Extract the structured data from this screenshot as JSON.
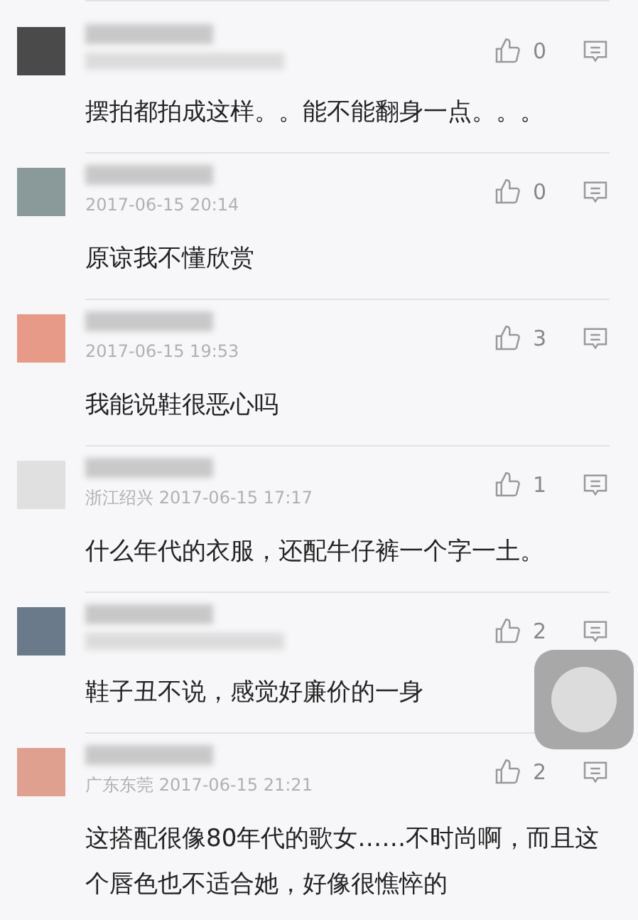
{
  "comments": [
    {
      "color": "#4a4a4a",
      "likes": "0",
      "text": "摆拍都拍成这样。。能不能翻身一点。。。"
    },
    {
      "color": "#8a9a9a",
      "meta": "2017-06-15 20:14",
      "likes": "0",
      "text": "原谅我不懂欣赏"
    },
    {
      "color": "#e89a88",
      "meta": "2017-06-15 19:53",
      "likes": "3",
      "text": "我能说鞋很恶心吗"
    },
    {
      "color": "#e0e0e0",
      "meta": "浙江绍兴 2017-06-15 17:17",
      "likes": "1",
      "text": "什么年代的衣服，还配牛仔裤一个字一土。"
    },
    {
      "color": "#6a7a8a",
      "likes": "2",
      "text": "鞋子丑不说，感觉好廉价的一身"
    },
    {
      "color": "#e0a090",
      "meta": "广东东莞 2017-06-15 21:21",
      "likes": "2",
      "text": "这搭配很像80年代的歌女……不时尚啊，而且这个唇色也不适合她，好像很憔悴的"
    }
  ]
}
